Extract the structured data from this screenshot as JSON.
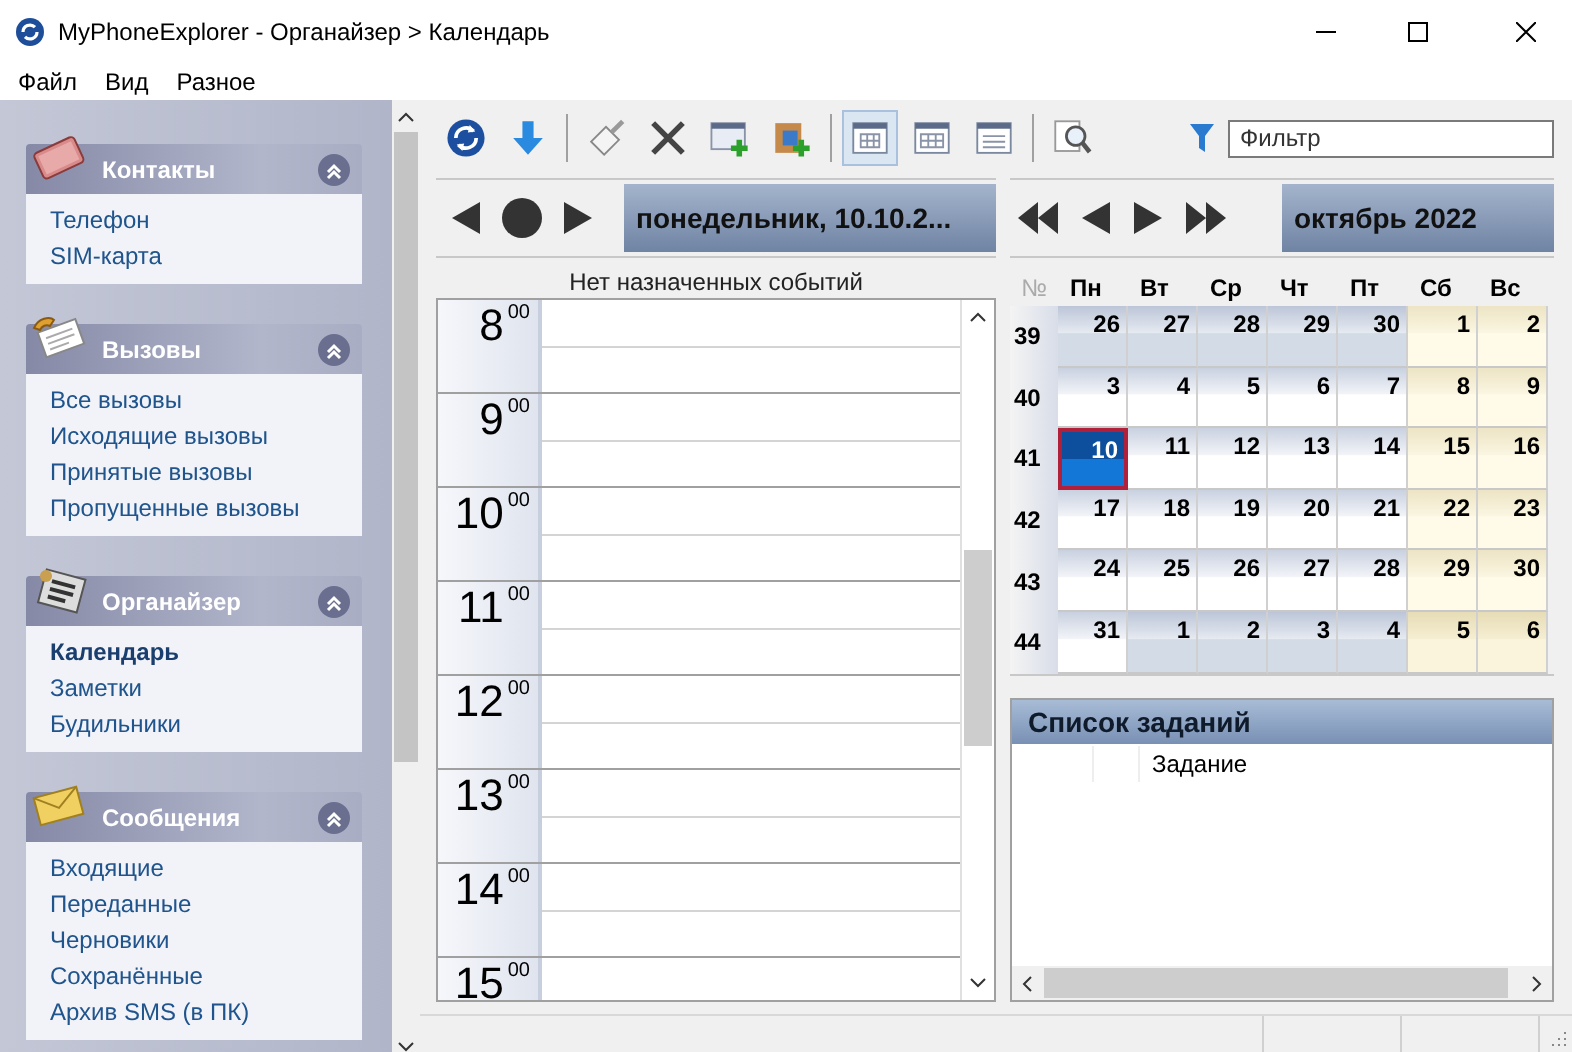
{
  "window": {
    "title": "MyPhoneExplorer -  Органайзер > Календарь"
  },
  "menu": [
    "Файл",
    "Вид",
    "Разное"
  ],
  "sidebar": {
    "groups": [
      {
        "kind": "contacts",
        "title": "Контакты",
        "expanded": true,
        "items": [
          {
            "label": "Телефон",
            "selected": false
          },
          {
            "label": "SIM-карта",
            "selected": false
          }
        ]
      },
      {
        "kind": "calls",
        "title": "Вызовы",
        "expanded": true,
        "items": [
          {
            "label": "Все вызовы",
            "selected": false
          },
          {
            "label": "Исходящие вызовы",
            "selected": false
          },
          {
            "label": "Принятые вызовы",
            "selected": false
          },
          {
            "label": "Пропущенные вызовы",
            "selected": false
          }
        ]
      },
      {
        "kind": "organizer",
        "title": "Органайзер",
        "expanded": true,
        "items": [
          {
            "label": "Календарь",
            "selected": true
          },
          {
            "label": "Заметки",
            "selected": false
          },
          {
            "label": "Будильники",
            "selected": false
          }
        ]
      },
      {
        "kind": "messages",
        "title": "Сообщения",
        "expanded": true,
        "items": [
          {
            "label": "Входящие",
            "selected": false
          },
          {
            "label": "Переданные",
            "selected": false
          },
          {
            "label": "Черновики",
            "selected": false
          },
          {
            "label": "Сохранённые",
            "selected": false
          },
          {
            "label": "Архив SMS (в ПК)",
            "selected": false
          }
        ]
      }
    ]
  },
  "toolbar": {
    "buttons": [
      {
        "kind": "refresh",
        "selected": false
      },
      {
        "kind": "download",
        "selected": false
      },
      {
        "kind": "separator"
      },
      {
        "kind": "edit",
        "selected": false
      },
      {
        "kind": "delete",
        "selected": false
      },
      {
        "kind": "add-event",
        "selected": false
      },
      {
        "kind": "add-import",
        "selected": false
      },
      {
        "kind": "separator"
      },
      {
        "kind": "view-day",
        "selected": true
      },
      {
        "kind": "view-week",
        "selected": false
      },
      {
        "kind": "view-list",
        "selected": false
      },
      {
        "kind": "separator"
      },
      {
        "kind": "find",
        "selected": false
      }
    ],
    "filter": {
      "placeholder": "Фильтр"
    }
  },
  "day_view": {
    "date_label": "понедельник, 10.10.2...",
    "caption": "Нет назначенных событий",
    "hours": [
      {
        "hour": "8",
        "minutes": "00"
      },
      {
        "hour": "9",
        "minutes": "00"
      },
      {
        "hour": "10",
        "minutes": "00"
      },
      {
        "hour": "11",
        "minutes": "00"
      },
      {
        "hour": "12",
        "minutes": "00"
      },
      {
        "hour": "13",
        "minutes": "00"
      },
      {
        "hour": "14",
        "minutes": "00"
      },
      {
        "hour": "15",
        "minutes": "00"
      }
    ]
  },
  "month_view": {
    "title": "октябрь 2022",
    "week_header": "№",
    "weekdays": [
      "Пн",
      "Вт",
      "Ср",
      "Чт",
      "Пт",
      "Сб",
      "Вс"
    ],
    "weeks": [
      {
        "number": "39",
        "days": [
          {
            "label": "26",
            "outside": true,
            "selected": false
          },
          {
            "label": "27",
            "outside": true,
            "selected": false
          },
          {
            "label": "28",
            "outside": true,
            "selected": false
          },
          {
            "label": "29",
            "outside": true,
            "selected": false
          },
          {
            "label": "30",
            "outside": true,
            "selected": false
          },
          {
            "label": "1",
            "outside": false,
            "selected": false
          },
          {
            "label": "2",
            "outside": false,
            "selected": false
          }
        ]
      },
      {
        "number": "40",
        "days": [
          {
            "label": "3",
            "outside": false,
            "selected": false
          },
          {
            "label": "4",
            "outside": false,
            "selected": false
          },
          {
            "label": "5",
            "outside": false,
            "selected": false
          },
          {
            "label": "6",
            "outside": false,
            "selected": false
          },
          {
            "label": "7",
            "outside": false,
            "selected": false
          },
          {
            "label": "8",
            "outside": false,
            "selected": false
          },
          {
            "label": "9",
            "outside": false,
            "selected": false
          }
        ]
      },
      {
        "number": "41",
        "days": [
          {
            "label": "10",
            "outside": false,
            "selected": true
          },
          {
            "label": "11",
            "outside": false,
            "selected": false
          },
          {
            "label": "12",
            "outside": false,
            "selected": false
          },
          {
            "label": "13",
            "outside": false,
            "selected": false
          },
          {
            "label": "14",
            "outside": false,
            "selected": false
          },
          {
            "label": "15",
            "outside": false,
            "selected": false
          },
          {
            "label": "16",
            "outside": false,
            "selected": false
          }
        ]
      },
      {
        "number": "42",
        "days": [
          {
            "label": "17",
            "outside": false,
            "selected": false
          },
          {
            "label": "18",
            "outside": false,
            "selected": false
          },
          {
            "label": "19",
            "outside": false,
            "selected": false
          },
          {
            "label": "20",
            "outside": false,
            "selected": false
          },
          {
            "label": "21",
            "outside": false,
            "selected": false
          },
          {
            "label": "22",
            "outside": false,
            "selected": false
          },
          {
            "label": "23",
            "outside": false,
            "selected": false
          }
        ]
      },
      {
        "number": "43",
        "days": [
          {
            "label": "24",
            "outside": false,
            "selected": false
          },
          {
            "label": "25",
            "outside": false,
            "selected": false
          },
          {
            "label": "26",
            "outside": false,
            "selected": false
          },
          {
            "label": "27",
            "outside": false,
            "selected": false
          },
          {
            "label": "28",
            "outside": false,
            "selected": false
          },
          {
            "label": "29",
            "outside": false,
            "selected": false
          },
          {
            "label": "30",
            "outside": false,
            "selected": false
          }
        ]
      },
      {
        "number": "44",
        "days": [
          {
            "label": "31",
            "outside": false,
            "selected": false
          },
          {
            "label": "1",
            "outside": true,
            "selected": false
          },
          {
            "label": "2",
            "outside": true,
            "selected": false
          },
          {
            "label": "3",
            "outside": true,
            "selected": false
          },
          {
            "label": "4",
            "outside": true,
            "selected": false
          },
          {
            "label": "5",
            "outside": true,
            "selected": false
          },
          {
            "label": "6",
            "outside": true,
            "selected": false
          }
        ]
      }
    ]
  },
  "tasks": {
    "title": "Список заданий",
    "task_column": "Задание"
  }
}
